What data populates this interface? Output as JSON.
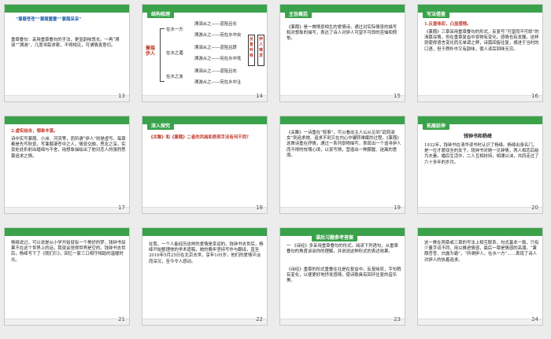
{
  "slides": [
    {
      "num": "13",
      "line1": "“蒹葭苍苍”“蒹葭萋萋”“蒹葭采采”",
      "body": "重章叠句：采用重章叠句的手法，更显韵味悠长。一再“溯洄”“溯游”，几度寻踪求索，不得相见，可谓情真意切。"
    },
    {
      "num": "14",
      "tab": "结构梳理",
      "left": "蒹葭伊人",
      "branches": [
        "在水一方",
        "在水之湄",
        "在水之涘"
      ],
      "leaves": [
        "溯洄从之——道阻且长",
        "溯游从之——宛在水中央",
        "溯洄从之——道阻且跻",
        "溯游从之——宛在水中坻",
        "溯洄从之——道阻且右",
        "溯游从之——宛在水中沚"
      ],
      "right": "反复吟咏",
      "right2": "伊人难求"
    },
    {
      "num": "15",
      "tab": "主旨概括",
      "body": "《蒹葭》是一首情景相生的爱情诗。通过对实际情景的描写和对想象的描写，表达了诗人对伊人可望不可即的苦恼和惆怅。"
    },
    {
      "num": "16",
      "tab": "写法借鉴",
      "h": "1.反复咏叹，凸显感情。",
      "body": "《蒹葭》三章采用重章叠句的形式，反复写“可望而不可即”的渴慕深情，但在重章复沓中景物有变化，感情也有发展。这样就使得语言变化而无单调之弊，诗篇回旋往复，揉进于当时的口语，但于质朴中又有韵味，使人读后回味无穷。"
    },
    {
      "num": "17",
      "h": "2.虚实结合，想象丰富。",
      "body": "诗中实写蒹葭、小洲、河流等，而所谓“伊人”则是虚写。每章都是先写秋景，写蒹葭凄苍中之人，情景交融，思念之深，实景处处折射出缠绵与不舍，用想象描绘出了他对恋人的强烈思慕追求之情。"
    },
    {
      "num": "18",
      "tab": "深入探究",
      "q": "《关雎》和《蒹葭》二者的风格和表现手法有何不同？"
    },
    {
      "num": "19",
      "body": "《关雎》一诗重在“叙事”，可以看出主人公从见到“窈窕淑女”到追求她、追求不到又在内心中辗转难眠的过程。《蒹葭》这首诗重在抒情，通过一系列景物描写，表现出一个追寻伊人而不得的怅惘心境，以景写情，营造出一种朦胧、迷离的意境。"
    },
    {
      "num": "20",
      "tab": "拓展延伸",
      "title": "钱钟书和杨绛",
      "body": "1932年，钱钟书在清华读书时认识了杨绛。杨绛出身名门，是一位才貌双全的女子，钱钟书对她一见钟情，两人相恋后结为夫妻。婚后生活中，二人互相扶持，相濡以沫，共同走过了六十多年的岁月。"
    },
    {
      "num": "21",
      "body": "杨绛说过，可以说是从小学开始就有一个美好的梦，钱钟书如果不在这个世界上的话，我就会觉得世界是空的。钱钟书去世后，杨绛写下了《我们仨》，回忆一家三口相守相助的温暖时光。"
    },
    {
      "num": "22",
      "body": "在我，一个人能经历这样的爱情是幸运的。钱钟书去世后，杨绛开始整理他的学术遗稿，她的晚年坚持写作与翻译，直至2016年5月25日在北京去世，享年105岁。他们的爱情平淡而深沉，至今令人感动。"
    },
    {
      "num": "23",
      "tab": "课后习题参考答案",
      "q": "一 《诗经》多采用重章叠句的形式。阅读下列语句，从重章叠句的角度谈谈你的理解，并说说这种形式的表达效果。",
      "body": "《诗经》重章的形式重叠往往是在复沓中，反复咏叹，字句稍有变化，以便更好地抒发感情，使诗歌具有回环往复的音乐美。"
    },
    {
      "num": "24",
      "body": "这一首在两章或三章的写法上相互联系，句式基本一致，只有少量字词不同，用以推进情感，最后一章是情感的高潮。“蒹葭苍苍、白露为霜”，“所谓伊人，在水一方”……表现了诗人对伊人的执着追求。"
    }
  ]
}
